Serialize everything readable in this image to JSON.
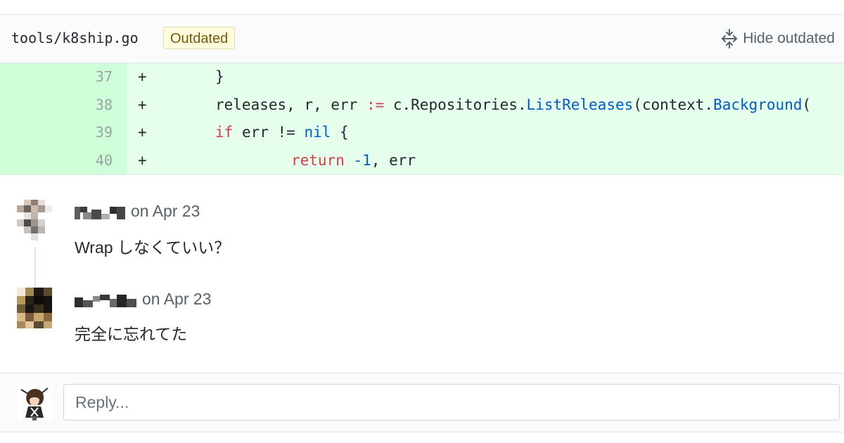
{
  "file": {
    "path": "tools/k8ship.go",
    "badge": "Outdated",
    "hide_label": "Hide outdated",
    "hide_icon": "fold-icon"
  },
  "diff": {
    "lines": [
      {
        "num": "37",
        "sign": "+"
      },
      {
        "num": "38",
        "sign": "+"
      },
      {
        "num": "39",
        "sign": "+"
      },
      {
        "num": "40",
        "sign": "+"
      }
    ],
    "code": {
      "l37": "}",
      "l38_a": "releases, r, err ",
      "l38_op": ":=",
      "l38_b": " c.Repositories.",
      "l38_fn": "ListReleases",
      "l38_c": "(context.",
      "l38_fn2": "Background",
      "l38_d": "(",
      "l39_kw": "if",
      "l39_a": " err != ",
      "l39_nil": "nil",
      "l39_b": " {",
      "l40_kw": "return",
      "l40_sp": " ",
      "l40_num": "-1",
      "l40_b": ", err"
    }
  },
  "comments": [
    {
      "date": "on Apr 23",
      "body": "Wrap しなくていい？"
    },
    {
      "date": "on Apr 23",
      "body": "完全に忘れてた"
    }
  ],
  "reply": {
    "placeholder": "Reply..."
  },
  "colors": {
    "added_bg": "#e6ffed",
    "added_num_bg": "#cdffd8",
    "keyword": "#d73a49",
    "function": "#005cc5",
    "badge_bg": "#fffbdd"
  }
}
